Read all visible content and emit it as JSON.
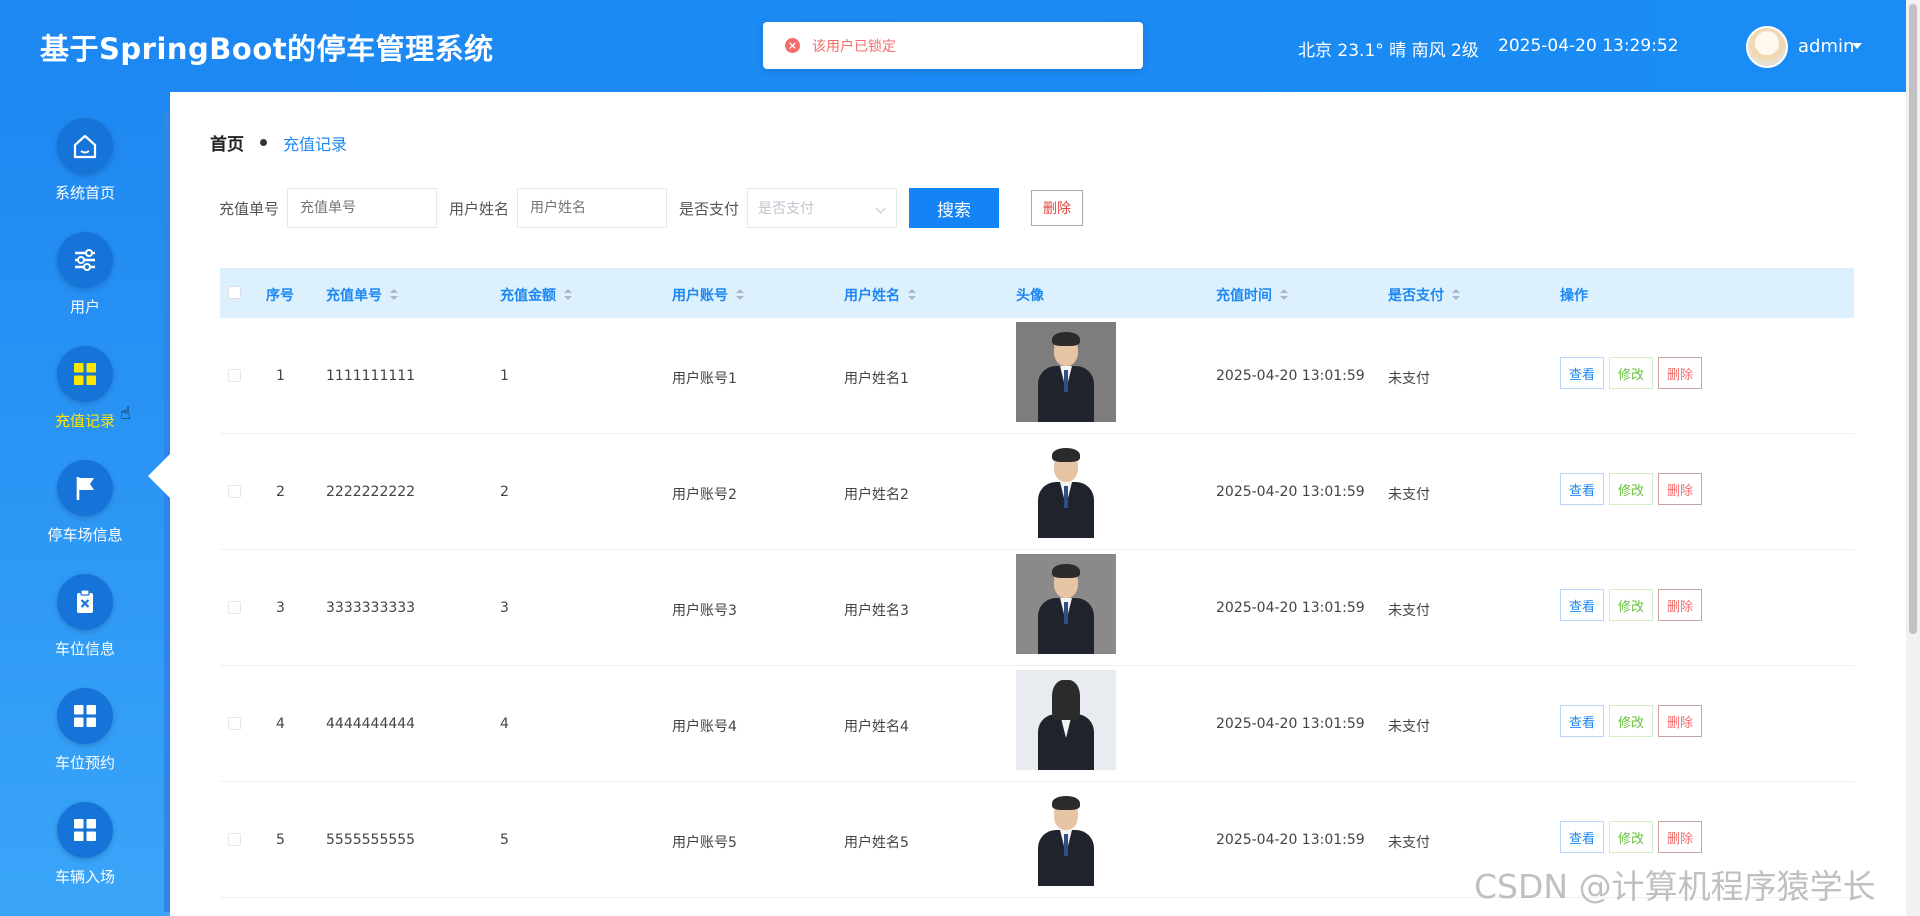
{
  "header": {
    "title": "基于SpringBoot的停车管理系统",
    "toast": "该用户已锁定",
    "weather": "北京  23.1°  晴  南风  2级",
    "datetime": "2025-04-20 13:29:52",
    "user": "admin"
  },
  "sidebar": {
    "items": [
      {
        "label": "系统首页",
        "icon": "home-icon"
      },
      {
        "label": "用户",
        "icon": "sliders-icon"
      },
      {
        "label": "充值记录",
        "icon": "grid-icon",
        "active": true
      },
      {
        "label": "停车场信息",
        "icon": "flag-icon"
      },
      {
        "label": "车位信息",
        "icon": "clipboard-x-icon"
      },
      {
        "label": "车位预约",
        "icon": "grid-icon"
      },
      {
        "label": "车辆入场",
        "icon": "grid-icon"
      }
    ]
  },
  "breadcrumb": {
    "home": "首页",
    "current": "充值记录"
  },
  "search": {
    "order_label": "充值单号",
    "order_placeholder": "充值单号",
    "name_label": "用户姓名",
    "name_placeholder": "用户姓名",
    "paid_label": "是否支付",
    "paid_placeholder": "是否支付",
    "search_button": "搜索",
    "delete_button": "删除"
  },
  "table": {
    "headers": [
      "序号",
      "充值单号",
      "充值金额",
      "用户账号",
      "用户姓名",
      "头像",
      "充值时间",
      "是否支付",
      "操作"
    ],
    "rows": [
      {
        "index": "1",
        "order": "1111111111",
        "amount": "1",
        "account": "用户账号1",
        "name": "用户姓名1",
        "time": "2025-04-20 13:01:59",
        "paid": "未支付"
      },
      {
        "index": "2",
        "order": "2222222222",
        "amount": "2",
        "account": "用户账号2",
        "name": "用户姓名2",
        "time": "2025-04-20 13:01:59",
        "paid": "未支付"
      },
      {
        "index": "3",
        "order": "3333333333",
        "amount": "3",
        "account": "用户账号3",
        "name": "用户姓名3",
        "time": "2025-04-20 13:01:59",
        "paid": "未支付"
      },
      {
        "index": "4",
        "order": "4444444444",
        "amount": "4",
        "account": "用户账号4",
        "name": "用户姓名4",
        "time": "2025-04-20 13:01:59",
        "paid": "未支付"
      },
      {
        "index": "5",
        "order": "5555555555",
        "amount": "5",
        "account": "用户账号5",
        "name": "用户姓名5",
        "time": "2025-04-20 13:01:59",
        "paid": "未支付"
      }
    ],
    "actions": {
      "view": "查看",
      "edit": "修改",
      "delete": "删除"
    }
  },
  "watermark": "CSDN @计算机程序猿学长",
  "colors": {
    "primary": "#1e88f2",
    "header_bg": "#dcf0fd",
    "active_label": "#ffe600",
    "danger": "#f56c6c",
    "success": "#67c23a"
  }
}
